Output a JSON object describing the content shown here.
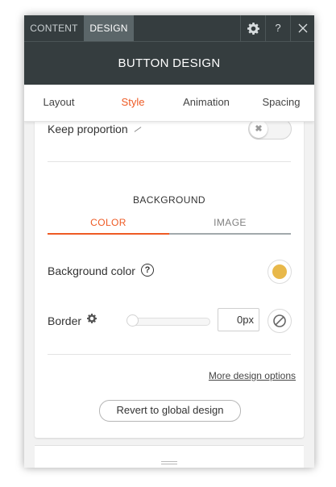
{
  "topbar": {
    "tabs": [
      {
        "label": "CONTENT",
        "active": false
      },
      {
        "label": "DESIGN",
        "active": true
      }
    ],
    "settings_icon": "gear-icon",
    "help_label": "?",
    "close_icon": "close-icon"
  },
  "panel_title": "BUTTON DESIGN",
  "subtabs": [
    {
      "label": "Layout",
      "active": false
    },
    {
      "label": "Style",
      "active": true
    },
    {
      "label": "Animation",
      "active": false
    },
    {
      "label": "Spacing",
      "active": false
    }
  ],
  "keep_proportion": {
    "label": "Keep proportion",
    "enabled": false
  },
  "background": {
    "heading": "BACKGROUND",
    "tabs": [
      {
        "label": "COLOR",
        "active": true
      },
      {
        "label": "IMAGE",
        "active": false
      }
    ],
    "color_label": "Background color",
    "color_value": "#e8b84a"
  },
  "border": {
    "label": "Border",
    "width_value": "0px",
    "slider_level": 0
  },
  "more_link": "More design options",
  "revert_button": "Revert to global design",
  "colors": {
    "accent": "#ee5a24",
    "header_bg": "#353d3f"
  }
}
